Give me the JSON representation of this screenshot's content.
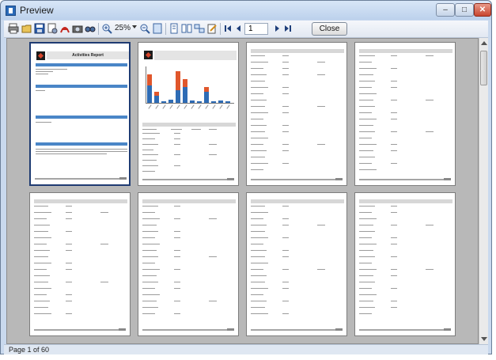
{
  "window": {
    "title": "Preview"
  },
  "toolbar": {
    "icons": [
      "print-icon",
      "open-icon",
      "save-icon",
      "print-setup-icon",
      "pdf-icon",
      "camera-icon",
      "find-icon",
      "zoom-in-icon",
      "zoom-out-icon",
      "fit-page-icon",
      "single-page-icon",
      "multi-page-icon",
      "thumbnails-icon",
      "edit-icon",
      "first-page-icon",
      "prev-page-icon",
      "next-page-icon",
      "last-page-icon"
    ],
    "zoom_value": "25%",
    "page_number": "1",
    "close_label": "Close"
  },
  "report": {
    "title": "Activities Report"
  },
  "status": {
    "page_text": "Page 1 of 60"
  },
  "colors": {
    "accent_blue": "#4a86c7",
    "bar_orange": "#e0572c",
    "bar_blue": "#2e6cb5",
    "viewer_bg": "#b8b8b8"
  }
}
